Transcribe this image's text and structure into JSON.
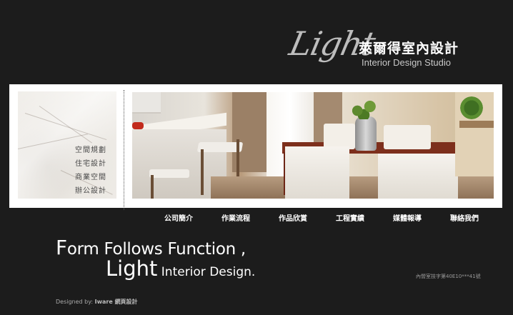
{
  "logo": {
    "script": "Light",
    "chinese": "萊爾得室內設計",
    "english": "Interior Design Studio"
  },
  "side_menu": [
    "空間規劃",
    "住宅設計",
    "商業空間",
    "辦公設計"
  ],
  "nav": [
    "公司簡介",
    "作業流程",
    "作品欣賞",
    "工程實績",
    "媒體報導",
    "聯絡我們"
  ],
  "slogan": {
    "line1_cap": "F",
    "line1_rest": "orm Follows Function ,",
    "line2_cap": "Light",
    "line2_rest": " Interior Design."
  },
  "license": "內營室技字第40E10***41號",
  "credit": {
    "prefix": "Designed by: ",
    "name": "Iware 網頁設計"
  },
  "colors": {
    "background": "#1c1c1c",
    "banner_frame": "#ffffff",
    "text": "#ffffff"
  }
}
